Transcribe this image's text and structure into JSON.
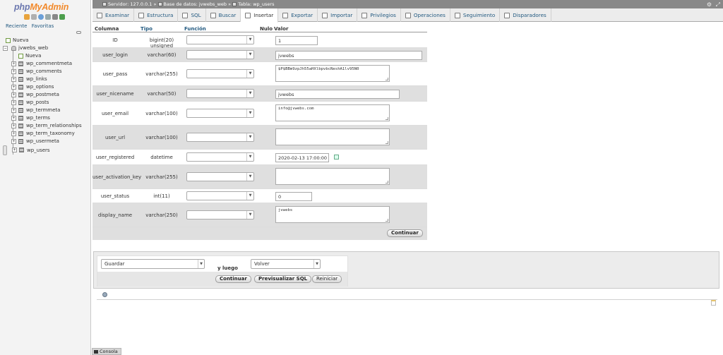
{
  "nav": {
    "logo_php": "php",
    "logo_myadmin": "MyAdmin",
    "tab_recent": "Reciente",
    "tab_favorites": "Favoritas",
    "tree": {
      "new_root": "Nueva",
      "database": "jvwebs_web",
      "new_table": "Nueva",
      "tables": [
        "wp_commentmeta",
        "wp_comments",
        "wp_links",
        "wp_options",
        "wp_postmeta",
        "wp_posts",
        "wp_termmeta",
        "wp_terms",
        "wp_term_relationships",
        "wp_term_taxonomy",
        "wp_usermeta",
        "wp_users"
      ],
      "selected_table": "wp_users"
    }
  },
  "breadcrumb": {
    "server": "Servidor: 127.0.0.1",
    "database": "Base de datos: jvwebs_web",
    "table": "Tabla: wp_users"
  },
  "tabs": [
    {
      "label": "Examinar",
      "icon": "browse-icon"
    },
    {
      "label": "Estructura",
      "icon": "structure-icon"
    },
    {
      "label": "SQL",
      "icon": "sql-icon"
    },
    {
      "label": "Buscar",
      "icon": "search-icon"
    },
    {
      "label": "Insertar",
      "icon": "insert-icon",
      "active": true
    },
    {
      "label": "Exportar",
      "icon": "export-icon"
    },
    {
      "label": "Importar",
      "icon": "import-icon"
    },
    {
      "label": "Privilegios",
      "icon": "privileges-icon"
    },
    {
      "label": "Operaciones",
      "icon": "operations-icon"
    },
    {
      "label": "Seguimiento",
      "icon": "tracking-icon"
    },
    {
      "label": "Disparadores",
      "icon": "triggers-icon"
    }
  ],
  "insert_form": {
    "headers": {
      "column": "Columna",
      "type": "Tipo",
      "function": "Función",
      "null": "Nulo",
      "value": "Valor"
    },
    "rows": [
      {
        "name": "ID",
        "type": "bigint(20) unsigned",
        "value": "1"
      },
      {
        "name": "user_login",
        "type": "varchar(60)",
        "value": "jvwebs"
      },
      {
        "name": "user_pass",
        "type": "varchar(255)",
        "value": "$P$BBm9zpJh55aHXlbpvbcNeshA1lv95N0"
      },
      {
        "name": "user_nicename",
        "type": "varchar(50)",
        "value": "jvwebs"
      },
      {
        "name": "user_email",
        "type": "varchar(100)",
        "value": "info@jvwebs.com"
      },
      {
        "name": "user_url",
        "type": "varchar(100)",
        "value": ""
      },
      {
        "name": "user_registered",
        "type": "datetime",
        "value": "2020-02-13 17:00:00"
      },
      {
        "name": "user_activation_key",
        "type": "varchar(255)",
        "value": ""
      },
      {
        "name": "user_status",
        "type": "int(11)",
        "value": "0"
      },
      {
        "name": "display_name",
        "type": "varchar(250)",
        "value": "jvwebs"
      }
    ],
    "continue_label": "Continuar"
  },
  "actions": {
    "save_select": "Guardar",
    "then_label": "y luego",
    "then_select": "Volver",
    "continue_label": "Continuar",
    "preview_sql_label": "Previsualizar SQL",
    "reset_label": "Reiniciar"
  },
  "console": {
    "label": "Consola"
  }
}
